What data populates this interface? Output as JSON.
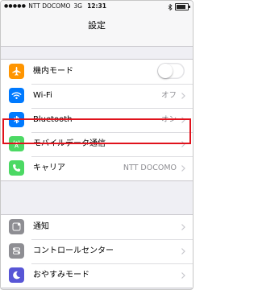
{
  "status": {
    "carrier": "NTT DOCOMO",
    "network": "3G",
    "time": "12:31"
  },
  "title": "設定",
  "group1": [
    {
      "label": "機内モード",
      "value": "",
      "icon": "airplane-icon",
      "color": "#ff9500",
      "control": "toggle",
      "toggle_on": false
    },
    {
      "label": "Wi-Fi",
      "value": "オフ",
      "icon": "wifi-icon",
      "color": "#007aff",
      "control": "chevron"
    },
    {
      "label": "Bluetooth",
      "value": "オン",
      "icon": "bluetooth-icon",
      "color": "#007aff",
      "control": "chevron"
    },
    {
      "label": "モバイルデータ通信",
      "value": "",
      "icon": "antenna-icon",
      "color": "#4cd964",
      "control": "chevron"
    },
    {
      "label": "キャリア",
      "value": "NTT DOCOMO",
      "icon": "phone-icon",
      "color": "#4cd964",
      "control": "chevron"
    }
  ],
  "group2": [
    {
      "label": "通知",
      "icon": "notifications-icon",
      "color": "#8e8e93"
    },
    {
      "label": "コントロールセンター",
      "icon": "control-center-icon",
      "color": "#8e8e93"
    },
    {
      "label": "おやすみモード",
      "icon": "moon-icon",
      "color": "#5856d6"
    }
  ],
  "highlight_color": "#e0121c"
}
